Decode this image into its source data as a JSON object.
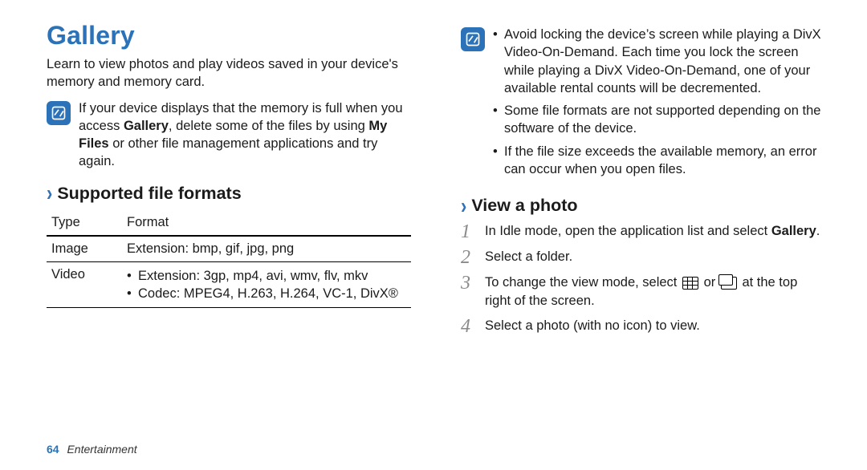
{
  "page": {
    "number": "64",
    "section": "Entertainment",
    "title": "Gallery",
    "intro": "Learn to view photos and play videos saved in your device's memory and memory card."
  },
  "note_left": {
    "pre": "If your device displays that the memory is full when you access ",
    "bold1": "Gallery",
    "mid": ", delete some of the files by using ",
    "bold2": "My Files",
    "post": " or other file management applications and try again."
  },
  "supported": {
    "heading": "Supported file formats",
    "table": {
      "head": {
        "type": "Type",
        "format": "Format"
      },
      "rows": [
        {
          "type": "Image",
          "format_plain": "Extension: bmp, gif, jpg, png"
        },
        {
          "type": "Video",
          "format_list": [
            "Extension: 3gp, mp4, avi, wmv, flv, mkv",
            "Codec: MPEG4, H.263, H.264, VC-1, DivX®"
          ]
        }
      ]
    }
  },
  "note_right": {
    "items": [
      "Avoid locking the device’s screen while playing a DivX Video-On-Demand. Each time you lock the screen while playing a DivX Video-On-Demand, one of your available rental counts will be decremented.",
      "Some file formats are not supported depending on the software of the device.",
      "If the file size exceeds the available memory, an error can occur when you open files."
    ]
  },
  "view": {
    "heading": "View a photo",
    "steps": {
      "s1_pre": "In Idle mode, open the application list and select ",
      "s1_bold": "Gallery",
      "s1_post": ".",
      "s2": "Select a folder.",
      "s3_pre": "To change the view mode, select ",
      "s3_mid": " or ",
      "s3_post": " at the top right of the screen.",
      "s4": "Select a photo (with no icon) to view."
    }
  },
  "icons": {
    "note": "note-icon",
    "grid": "grid-icon",
    "stack": "stack-icon"
  }
}
